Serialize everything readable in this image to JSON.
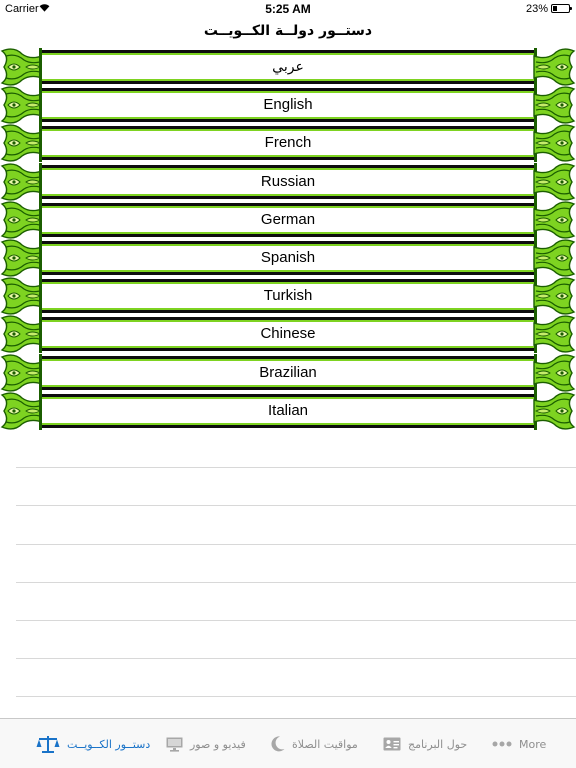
{
  "status_bar": {
    "carrier": "Carrier",
    "time": "5:25 AM",
    "battery": "23%",
    "battery_level": 0.23
  },
  "nav": {
    "title": "دستــور دولــة الكــويــت"
  },
  "languages": [
    "عربي",
    "English",
    "French",
    "Russian",
    "German",
    "Spanish",
    "Turkish",
    "Chinese",
    "Brazilian",
    "Italian"
  ],
  "tabs": [
    {
      "label": "دستــور الكــويــت",
      "icon": "scales-icon",
      "active": true
    },
    {
      "label": "فيديو و صور",
      "icon": "monitor-icon",
      "active": false
    },
    {
      "label": "مواقيت الصلاة",
      "icon": "moon-icon",
      "active": false
    },
    {
      "label": "حول البرنامج",
      "icon": "contact-card-icon",
      "active": false
    },
    {
      "label": "More",
      "icon": "more-dots-icon",
      "active": false
    }
  ],
  "colors": {
    "ornament_green": "#7ed321",
    "ornament_dark": "#1b5e00",
    "tab_active": "#1a73c8",
    "tab_inactive": "#8e8e8e"
  }
}
